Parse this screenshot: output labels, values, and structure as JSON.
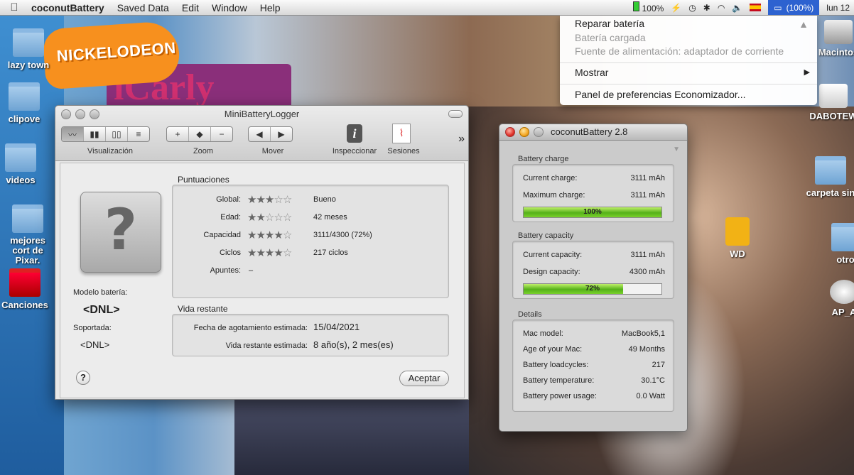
{
  "menubar": {
    "apple_glyph": "",
    "app_name": "coconutBattery",
    "items": [
      "Saved Data",
      "Edit",
      "Window",
      "Help"
    ],
    "battery_pct": "100%",
    "battery_menu_label": "(100%)",
    "clock": "lun 12"
  },
  "battery_menu": {
    "repair": "Reparar batería",
    "status": "Batería cargada",
    "source": "Fuente de alimentación: adaptador de corriente",
    "show": "Mostrar",
    "prefs": "Panel de preferencias Economizador..."
  },
  "desktop": {
    "left_icons": [
      "lazy town",
      "clipove",
      "videos",
      "mejores cort de Pixar.",
      "Canciones"
    ],
    "right_icons": [
      "Macintos",
      "DABOTEW",
      "carpeta sin",
      "WD",
      "otro",
      "AP_A"
    ],
    "nick_logo": "NICKELODEON",
    "icarly_text": "iCarly"
  },
  "mbl": {
    "title": "MiniBatteryLogger",
    "toolbar": {
      "visualizacion": "Visualización",
      "zoom": "Zoom",
      "mover": "Mover",
      "inspeccionar": "Inspeccionar",
      "sesiones": "Sesiones",
      "more": "»"
    },
    "modelo_label": "Modelo batería:",
    "modelo_value": "<DNL>",
    "soportada_label": "Soportada:",
    "soportada_value": "<DNL>",
    "puntuaciones_title": "Puntuaciones",
    "ratings": [
      {
        "label": "Global:",
        "stars": 3,
        "value": "Bueno"
      },
      {
        "label": "Edad:",
        "stars": 2,
        "value": "42 meses"
      },
      {
        "label": "Capacidad",
        "stars": 4,
        "value": "3111/4300 (72%)"
      },
      {
        "label": "Ciclos",
        "stars": 4,
        "value": "217 ciclos"
      }
    ],
    "apuntes_label": "Apuntes:",
    "apuntes_value": "–",
    "vida_title": "Vida restante",
    "fecha_label": "Fecha de agotamiento estimada:",
    "fecha_value": "15/04/2021",
    "vida_label": "Vida restante estimada:",
    "vida_value": "8 año(s), 2 mes(es)",
    "aceptar": "Aceptar",
    "help": "?"
  },
  "cb": {
    "title": "coconutBattery 2.8",
    "charge_title": "Battery charge",
    "current_charge_label": "Current charge:",
    "current_charge_value": "3111 mAh",
    "max_charge_label": "Maximum charge:",
    "max_charge_value": "3111 mAh",
    "charge_pct_label": "100%",
    "charge_fraction": 1.0,
    "capacity_title": "Battery capacity",
    "current_capacity_label": "Current capacity:",
    "current_capacity_value": "3111 mAh",
    "design_capacity_label": "Design capacity:",
    "design_capacity_value": "4300 mAh",
    "capacity_pct_label": "72%",
    "capacity_fraction": 0.72,
    "details_title": "Details",
    "details": [
      {
        "label": "Mac model:",
        "value": "MacBook5,1"
      },
      {
        "label": "Age of your Mac:",
        "value": "49 Months"
      },
      {
        "label": "Battery loadcycles:",
        "value": "217"
      },
      {
        "label": "Battery temperature:",
        "value": "30.1°C"
      },
      {
        "label": "Battery power usage:",
        "value": "0.0 Watt"
      }
    ]
  }
}
